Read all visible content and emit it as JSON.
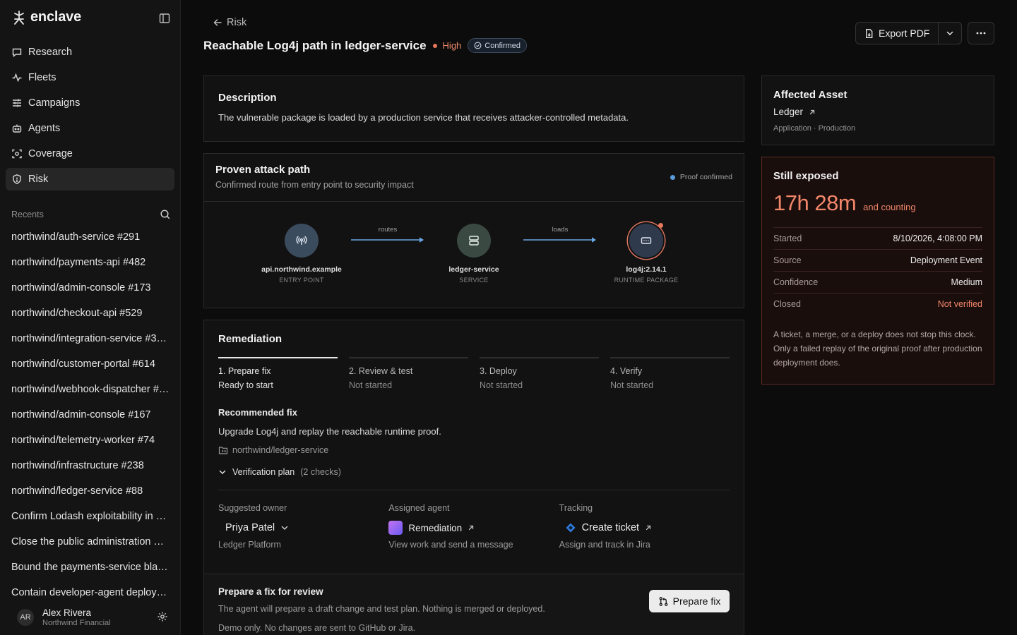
{
  "brand": {
    "name": "enclave"
  },
  "sidebar": {
    "nav": [
      {
        "label": "Research",
        "icon": "chat-icon"
      },
      {
        "label": "Fleets",
        "icon": "activity-icon"
      },
      {
        "label": "Campaigns",
        "icon": "sliders-icon"
      },
      {
        "label": "Agents",
        "icon": "bot-icon"
      },
      {
        "label": "Coverage",
        "icon": "scan-icon"
      },
      {
        "label": "Risk",
        "icon": "shield-icon",
        "active": true
      }
    ],
    "recents_label": "Recents",
    "recents": [
      "northwind/auth-service #291",
      "northwind/payments-api #482",
      "northwind/admin-console #173",
      "northwind/checkout-api #529",
      "northwind/integration-service #3…",
      "northwind/customer-portal #614",
      "northwind/webhook-dispatcher #…",
      "northwind/admin-console #167",
      "northwind/telemetry-worker #74",
      "northwind/infrastructure #238",
      "northwind/ledger-service #88",
      "Confirm Lodash exploitability in p…",
      "Close the public administration p…",
      "Bound the payments-service bla…",
      "Contain developer-agent deploy…"
    ],
    "user": {
      "initials": "AR",
      "name": "Alex Rivera",
      "org": "Northwind Financial"
    }
  },
  "header": {
    "back_label": "Risk",
    "title": "Reachable Log4j path in ledger-service",
    "severity": "High",
    "status_badge": "Confirmed",
    "export_label": "Export PDF"
  },
  "description": {
    "title": "Description",
    "text": "The vulnerable package is loaded by a production service that receives attacker-controlled metadata."
  },
  "attack_path": {
    "title": "Proven attack path",
    "subtitle": "Confirmed route from entry point to security impact",
    "status": "Proof confirmed",
    "nodes": [
      {
        "name": "api.northwind.example",
        "type": "ENTRY POINT",
        "color": "#3b4b5e"
      },
      {
        "name": "ledger-service",
        "type": "SERVICE",
        "color": "#3a4a42"
      },
      {
        "name": "log4j:2.14.1",
        "type": "RUNTIME PACKAGE",
        "color": "#2f3a4c"
      }
    ],
    "edges": [
      "routes",
      "loads"
    ]
  },
  "remediation": {
    "title": "Remediation",
    "steps": [
      {
        "title": "1.  Prepare fix",
        "status": "Ready to start"
      },
      {
        "title": "2.  Review & test",
        "status": "Not started"
      },
      {
        "title": "3.  Deploy",
        "status": "Not started"
      },
      {
        "title": "4.  Verify",
        "status": "Not started"
      }
    ],
    "recommended_label": "Recommended fix",
    "recommended_text": "Upgrade Log4j and replay the reachable runtime proof.",
    "repo": "northwind/ledger-service",
    "plan_label": "Verification plan",
    "plan_count": "(2 checks)",
    "owner": {
      "label": "Suggested owner",
      "value": "Priya Patel",
      "sub": "Ledger Platform"
    },
    "agent": {
      "label": "Assigned agent",
      "value": "Remediation",
      "sub": "View work and send a message"
    },
    "tracking": {
      "label": "Tracking",
      "value": "Create ticket",
      "sub": "Assign and track in Jira"
    },
    "prepare": {
      "title": "Prepare a fix for review",
      "text": "The agent will prepare a draft change and test plan. Nothing is merged or deployed.",
      "note": "Demo only. No changes are sent to GitHub or Jira.",
      "button": "Prepare fix"
    }
  },
  "asset": {
    "title": "Affected Asset",
    "name": "Ledger",
    "meta": "Application · Production"
  },
  "exposure": {
    "title": "Still exposed",
    "duration": "17h 28m",
    "counting": "and counting",
    "rows": [
      {
        "key": "Started",
        "value": "8/10/2026, 4:08:00 PM"
      },
      {
        "key": "Source",
        "value": "Deployment Event"
      },
      {
        "key": "Confidence",
        "value": "Medium"
      },
      {
        "key": "Closed",
        "value": "Not verified"
      }
    ],
    "note": "A ticket, a merge, or a deploy does not stop this clock. Only a failed replay of the original proof after production deployment does."
  }
}
